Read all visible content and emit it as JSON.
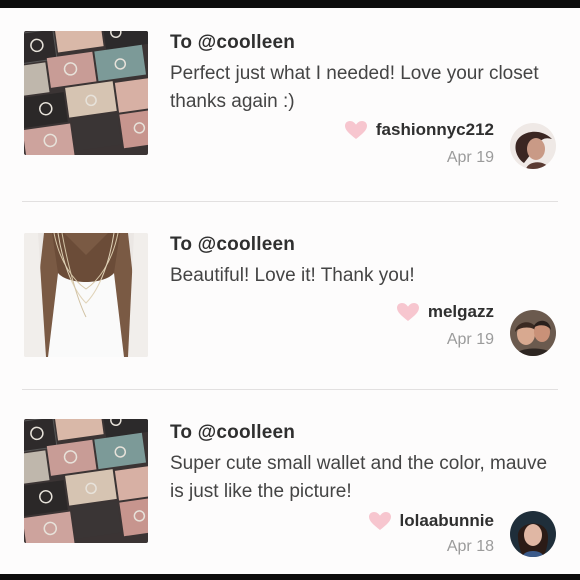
{
  "reviews": [
    {
      "to": "To @coolleen",
      "message": "Perfect just what I needed! Love your closet thanks again :)",
      "username": "fashionnyc212",
      "date": "Apr 19",
      "thumbnail": "wallets-photo",
      "avatar": "user-avatar"
    },
    {
      "to": "To @coolleen",
      "message": "Beautiful! Love it! Thank you!",
      "username": "melgazz",
      "date": "Apr 19",
      "thumbnail": "necklace-photo",
      "avatar": "user-avatar"
    },
    {
      "to": "To @coolleen",
      "message": "Super cute small wallet and the color, mauve is just like the picture!",
      "username": "lolaabunnie",
      "date": "Apr 18",
      "thumbnail": "wallets-photo",
      "avatar": "user-avatar"
    }
  ],
  "colors": {
    "heart": "#f7c6cf",
    "username": "#2f2f2f",
    "date": "#9b9b9b",
    "divider": "#e2e0e0"
  }
}
